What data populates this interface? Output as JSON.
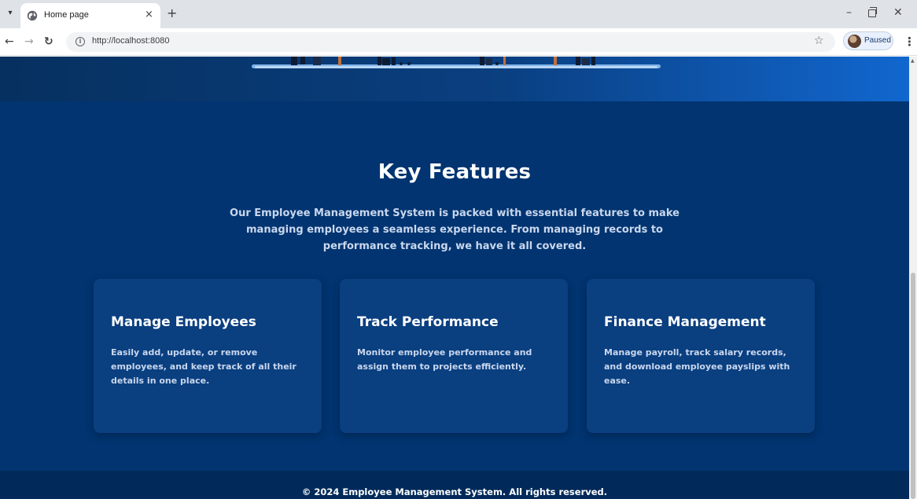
{
  "browser": {
    "tab_title": "Home page",
    "tab_close": "×",
    "new_tab": "+",
    "url": "http://localhost:8080",
    "profile_status": "Paused",
    "window_controls": {
      "minimize": "–",
      "close": "✕"
    }
  },
  "features": {
    "title": "Key Features",
    "intro": "Our Employee Management System is packed with essential features to make managing employees a seamless experience. From managing records to performance tracking, we have it all covered.",
    "cards": [
      {
        "title": "Manage Employees",
        "text": "Easily add, update, or remove employees, and keep track of all their details in one place."
      },
      {
        "title": "Track Performance",
        "text": "Monitor employee performance and assign them to projects efficiently."
      },
      {
        "title": "Finance Management",
        "text": "Manage payroll, track salary records, and download employee payslips with ease."
      }
    ]
  },
  "footer": {
    "text": "© 2024 Employee Management System. All rights reserved."
  },
  "colors": {
    "page_bg": "#013470",
    "card_bg": "#0a3f80",
    "footer_bg": "#012a5a",
    "body_text": "#c9d7ee",
    "heading_text": "#ffffff"
  }
}
